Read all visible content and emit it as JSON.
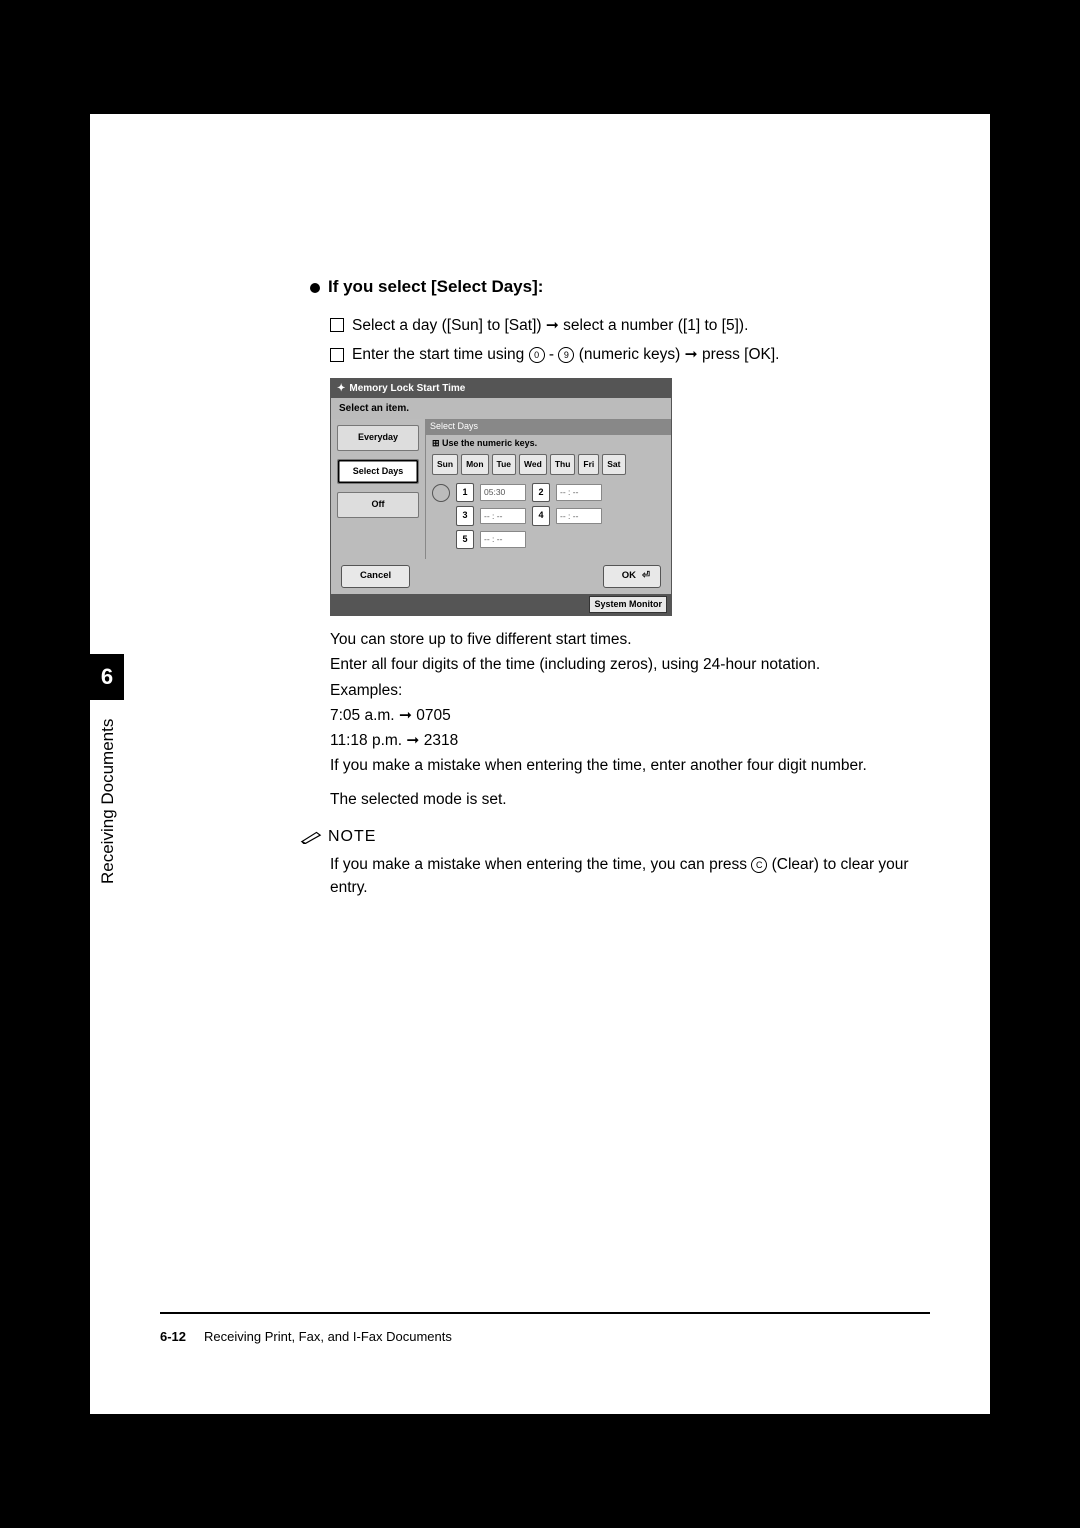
{
  "heading": "If you select [Select Days]:",
  "steps": {
    "s1_a": "Select a day ([Sun] to [Sat]) ",
    "s1_b": " select a number ([1] to [5]).",
    "s2_a": "Enter the start time using ",
    "s2_b": " - ",
    "s2_c": " (numeric keys) ",
    "s2_d": " press [OK]."
  },
  "arrow": "➞",
  "circ0": "0",
  "circ9": "9",
  "circC": "C",
  "panel": {
    "title": "Memory Lock Start Time",
    "subtitle": "Select an item.",
    "rightTitle": "Select Days",
    "hint": "Use the numeric keys.",
    "opts": {
      "everyday": "Everyday",
      "selectdays": "Select Days",
      "off": "Off"
    },
    "days": {
      "sun": "Sun",
      "mon": "Mon",
      "tue": "Tue",
      "wed": "Wed",
      "thu": "Thu",
      "fri": "Fri",
      "sat": "Sat"
    },
    "nums": {
      "n1": "1",
      "n2": "2",
      "n3": "3",
      "n4": "4",
      "n5": "5"
    },
    "times": {
      "t1": "05:30",
      "blank": "-- : --"
    },
    "cancel": "Cancel",
    "ok": "OK",
    "sysmon": "System Monitor"
  },
  "body": {
    "l1": "You can store up to five different start times.",
    "l2": "Enter all four digits of the time (including zeros), using 24-hour notation.",
    "l3": "Examples:",
    "l4a": "7:05 a.m. ",
    "l4b": " 0705",
    "l5a": "11:18 p.m. ",
    "l5b": " 2318",
    "l6": "If you make a mistake when entering the time, enter another four digit number.",
    "l7": "The selected mode is set."
  },
  "note": {
    "label": "NOTE",
    "text_a": "If you make a mistake when entering the time, you can press ",
    "text_b": " (Clear) to clear your entry."
  },
  "sidetab": {
    "num": "6",
    "label": "Receiving Documents"
  },
  "footer": {
    "pagenum": "6-12",
    "title": "Receiving Print, Fax, and I-Fax Documents"
  }
}
